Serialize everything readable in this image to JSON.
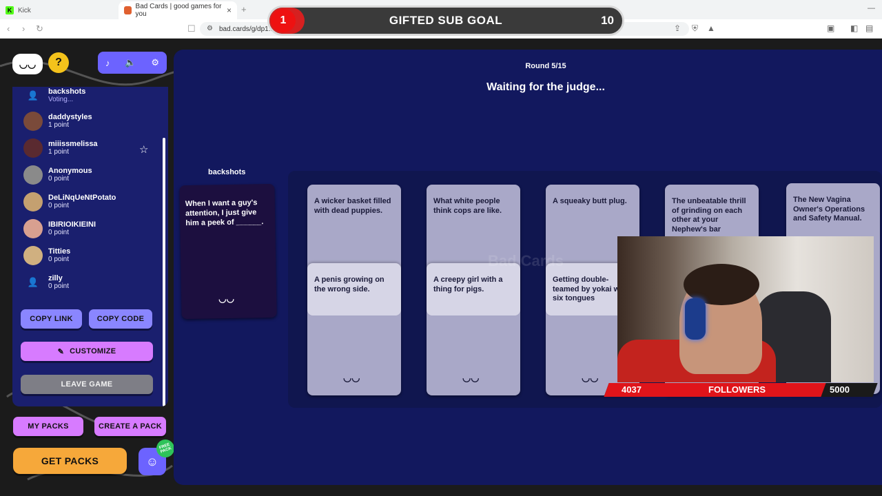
{
  "browser": {
    "tabs": [
      {
        "label": "Kick"
      },
      {
        "label": "Bad Cards | good games for you"
      }
    ],
    "url": "bad.cards/g/dp1...l8b6m0y1"
  },
  "goal": {
    "current": "1",
    "title": "GIFTED SUB GOAL",
    "target": "10",
    "progress_fraction": 0.1
  },
  "sidebar": {
    "players": [
      {
        "name": "backshots",
        "status": "Voting..."
      },
      {
        "name": "daddystyles",
        "status": "1 point"
      },
      {
        "name": "miiissmelissa",
        "status": "1 point"
      },
      {
        "name": "Anonymous",
        "status": "0 point"
      },
      {
        "name": "DeLiNqUeNtPotato",
        "status": "0 point"
      },
      {
        "name": "IBIRIOIKIEINI",
        "status": "0 point"
      },
      {
        "name": "Titties",
        "status": "0 point"
      },
      {
        "name": "zilly",
        "status": "0 point"
      }
    ],
    "copy_link": "COPY LINK",
    "copy_code": "COPY CODE",
    "customize": "CUSTOMIZE",
    "leave_game": "LEAVE GAME",
    "my_packs": "MY PACKS",
    "create_pack": "CREATE A PACK",
    "get_packs": "GET PACKS",
    "free_badge": "FREE PACK"
  },
  "game": {
    "round": "Round 5/15",
    "status": "Waiting for the judge...",
    "judge_name": "backshots",
    "question": "When I want a guy's attention, I just give him a peek of ______.",
    "answers": [
      {
        "back": "A wicker basket filled with dead puppies.",
        "front": "A penis growing on the wrong side."
      },
      {
        "back": "What white people think cops are like.",
        "front": "A creepy girl with a thing for pigs."
      },
      {
        "back": "A squeaky butt plug.",
        "front": "Getting double-teamed by yokai with six tongues"
      },
      {
        "back": "The unbeatable thrill of grinding on each other at your Nephew's bar",
        "front": ""
      },
      {
        "back": "The New Vagina Owner's Operations and Safety Manual.",
        "front": ""
      }
    ],
    "watermark": "Bad Cards"
  },
  "stream": {
    "followers_current": "4037",
    "followers_label": "FOLLOWERS",
    "followers_target": "5000",
    "followers_fraction": 0.807
  },
  "colors": {
    "game_bg": "#12185e",
    "panel_bg": "#1a1f6e",
    "accent_blue": "#8a86ff",
    "accent_pink": "#d77bff",
    "accent_orange": "#f6a83a",
    "goal_red": "#e0141a"
  }
}
